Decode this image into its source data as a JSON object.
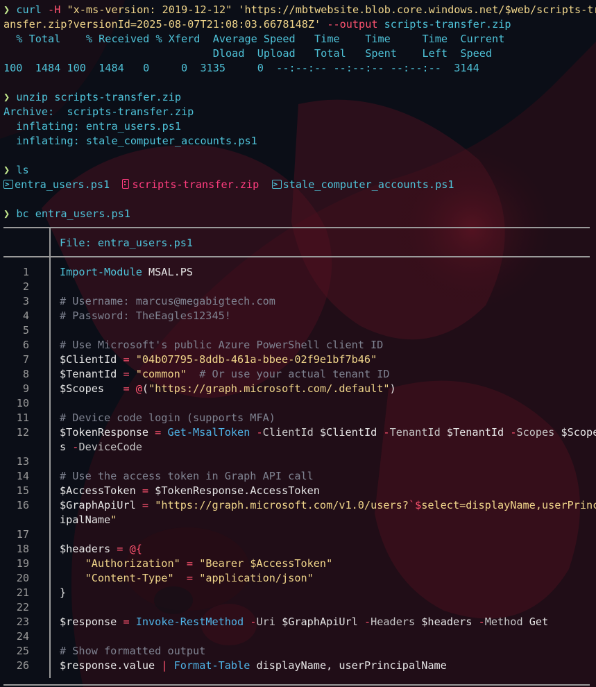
{
  "terminal": {
    "curl_cmd": {
      "prompt": "❯",
      "cmd": "curl",
      "flag_h": "-H",
      "header": "\"x-ms-version: 2019-12-12\"",
      "url_line1": "'https://mbtwebsite.blob.core.windows.net/$web/scripts-tr",
      "url_line2": "ansfer.zip?versionId=2025-08-07T21:08:03.6678148Z'",
      "flag_o": "--output",
      "out": "scripts-transfer.zip"
    },
    "curl_progress": {
      "header1": "  % Total    % Received % Xferd  Average Speed   Time    Time     Time  Current",
      "header2": "                                 Dload  Upload   Total   Spent    Left  Speed",
      "row": "100  1484 100  1484   0     0  3135     0  --:--:-- --:--:-- --:--:--  3144"
    },
    "unzip_cmd": {
      "prompt": "❯",
      "cmd": "unzip",
      "arg": "scripts-transfer.zip",
      "archive_label": "Archive:",
      "archive_name": "scripts-transfer.zip",
      "inflating_label": "inflating:",
      "files": [
        "entra_users.ps1",
        "stale_computer_accounts.ps1"
      ]
    },
    "ls_cmd": {
      "prompt": "❯",
      "cmd": "ls",
      "entries": [
        {
          "name": "entra_users.ps1",
          "icon": "powershell-icon"
        },
        {
          "name": "scripts-transfer.zip",
          "icon": "zip-icon"
        },
        {
          "name": "stale_computer_accounts.ps1",
          "icon": "powershell-icon"
        }
      ]
    },
    "bc_cmd": {
      "prompt": "❯",
      "cmd": "bc",
      "arg": "entra_users.ps1"
    },
    "viewer": {
      "file_label": "File:",
      "file_name": "entra_users.ps1",
      "line_numbers": [
        "1",
        "2",
        "3",
        "4",
        "5",
        "6",
        "7",
        "8",
        "9",
        "10",
        "11",
        "12",
        "",
        "13",
        "14",
        "15",
        "16",
        "",
        "17",
        "18",
        "19",
        "20",
        "21",
        "22",
        "23",
        "24",
        "25",
        "26"
      ],
      "code_lines": [
        "Import-Module MSAL.PS",
        "",
        "# Username: marcus@megabigtech.com",
        "# Password: TheEagles12345!",
        "",
        "# Use Microsoft's public Azure PowerShell client ID",
        "$ClientId = \"04b07795-8ddb-461a-bbee-02f9e1bf7b46\"",
        "$TenantId = \"common\"  # Or use your actual tenant ID",
        "$Scopes   = @(\"https://graph.microsoft.com/.default\")",
        "",
        "# Device code login (supports MFA)",
        "$TokenResponse = Get-MsalToken -ClientId $ClientId -TenantId $TenantId -Scopes $Scope",
        "s -DeviceCode",
        "",
        "# Use the access token in Graph API call",
        "$AccessToken = $TokenResponse.AccessToken",
        "$GraphApiUrl = \"https://graph.microsoft.com/v1.0/users?`$select=displayName,userPrinc",
        "ipalName\"",
        "",
        "$headers = @{",
        "    \"Authorization\" = \"Bearer $AccessToken\"",
        "    \"Content-Type\"  = \"application/json\"",
        "}",
        "",
        "$response = Invoke-RestMethod -Uri $GraphApiUrl -Headers $headers -Method Get",
        "",
        "# Show formatted output",
        "$response.value | Format-Table displayName, userPrincipalName"
      ]
    }
  },
  "colors": {
    "background": "#0b0e17",
    "accent_cyan": "#4fc3d9",
    "string_yellow": "#f0d58a",
    "operator_red": "#ff5370",
    "zip_pink": "#ff3d7f",
    "comment": "#7f8391",
    "prompt_green": "#c3e88d",
    "wallpaper_red": "#5a1420"
  }
}
